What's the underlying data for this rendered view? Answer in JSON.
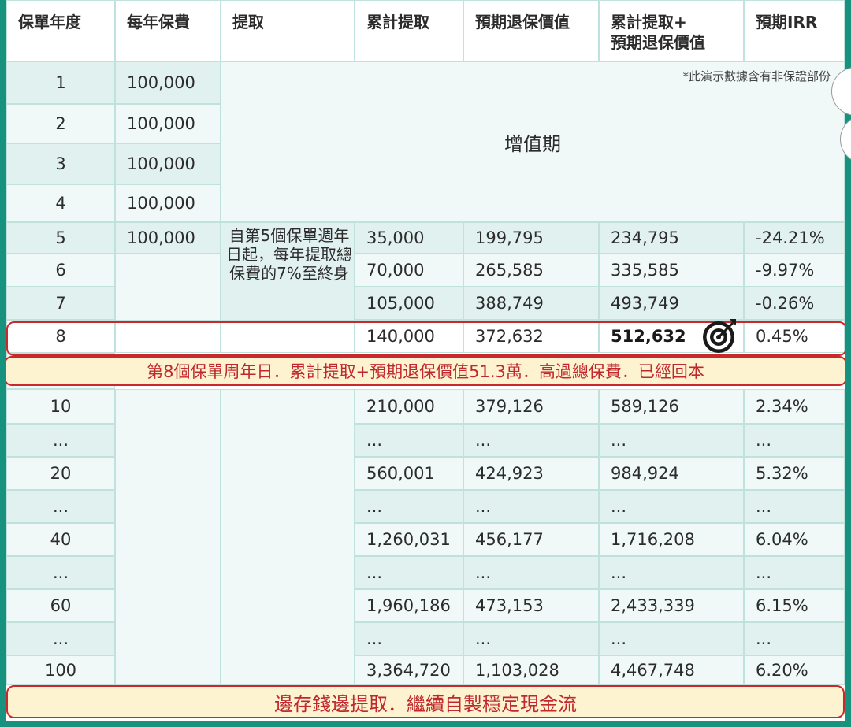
{
  "headers": [
    "保單年度",
    "每年保費",
    "提取",
    "累計提取",
    "預期退保價值",
    "累計提取+\n預期退保價值",
    "預期IRR"
  ],
  "header_line1": "累計提取+",
  "header_line2": "預期退保價值",
  "note": "*此演示數據含有非保證部份",
  "growth_period": "增值期",
  "withdraw_desc": "自第5個保單週年日起，每年提取總保費的7%至終身",
  "early_rows": [
    {
      "year": "1",
      "premium": "100,000"
    },
    {
      "year": "2",
      "premium": "100,000"
    },
    {
      "year": "3",
      "premium": "100,000"
    },
    {
      "year": "4",
      "premium": "100,000"
    }
  ],
  "rows": [
    {
      "year": "5",
      "premium": "100,000",
      "cum": "35,000",
      "surr": "199,795",
      "total": "234,795",
      "irr": "-24.21%"
    },
    {
      "year": "6",
      "premium": "",
      "cum": "70,000",
      "surr": "265,585",
      "total": "335,585",
      "irr": "-9.97%"
    },
    {
      "year": "7",
      "premium": "",
      "cum": "105,000",
      "surr": "388,749",
      "total": "493,749",
      "irr": "-0.26%"
    },
    {
      "year": "8",
      "premium": "",
      "cum": "140,000",
      "surr": "372,632",
      "total": "512,632",
      "irr": "0.45%"
    },
    {
      "year": "10",
      "premium": "",
      "cum": "210,000",
      "surr": "379,126",
      "total": "589,126",
      "irr": "2.34%"
    },
    {
      "year": "...",
      "premium": "",
      "cum": "...",
      "surr": "...",
      "total": "...",
      "irr": "..."
    },
    {
      "year": "20",
      "premium": "",
      "cum": "560,001",
      "surr": "424,923",
      "total": "984,924",
      "irr": "5.32%"
    },
    {
      "year": "...",
      "premium": "",
      "cum": "...",
      "surr": "...",
      "total": "...",
      "irr": "..."
    },
    {
      "year": "40",
      "premium": "",
      "cum": "1,260,031",
      "surr": "456,177",
      "total": "1,716,208",
      "irr": "6.04%"
    },
    {
      "year": "...",
      "premium": "",
      "cum": "...",
      "surr": "...",
      "total": "...",
      "irr": "..."
    },
    {
      "year": "60",
      "premium": "",
      "cum": "1,960,186",
      "surr": "473,153",
      "total": "2,433,339",
      "irr": "6.15%"
    },
    {
      "year": "...",
      "premium": "",
      "cum": "...",
      "surr": "...",
      "total": "...",
      "irr": "..."
    },
    {
      "year": "100",
      "premium": "",
      "cum": "3,364,720",
      "surr": "1,103,028",
      "total": "4,467,748",
      "irr": "6.20%"
    }
  ],
  "callout_year8": "第8個保單周年日．累計提取+預期退保價值51.3萬．高過總保費．已經回本",
  "callout_bottom": "邊存錢邊提取．繼續自製穩定現金流",
  "target_icon": "target-icon",
  "colors": {
    "frame": "#17927f",
    "row_dark": "#e1f1ef",
    "row_light": "#f0f9f8",
    "callout_bg": "#fdf3d0",
    "callout_text": "#c0282d"
  }
}
